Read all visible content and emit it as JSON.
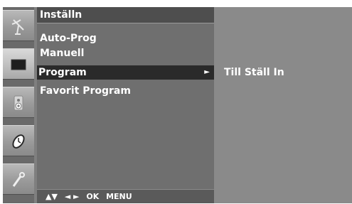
{
  "menu": {
    "title": "Inställn",
    "items": [
      {
        "label": "Auto-Prog"
      },
      {
        "label": "Manuell"
      },
      {
        "label": "Program",
        "selected": true
      },
      {
        "label": "Favorit Program"
      }
    ],
    "selected_arrow": "►"
  },
  "footer": {
    "updown": "▲▼",
    "leftright": "◄ ►",
    "ok": "OK",
    "menu": "MENU"
  },
  "submenu": {
    "item": "Till Ställ In"
  },
  "sidebar": {
    "icons": [
      {
        "name": "antenna-icon"
      },
      {
        "name": "picture-icon",
        "active": true
      },
      {
        "name": "audio-icon"
      },
      {
        "name": "clock-icon"
      },
      {
        "name": "settings-icon"
      }
    ]
  }
}
